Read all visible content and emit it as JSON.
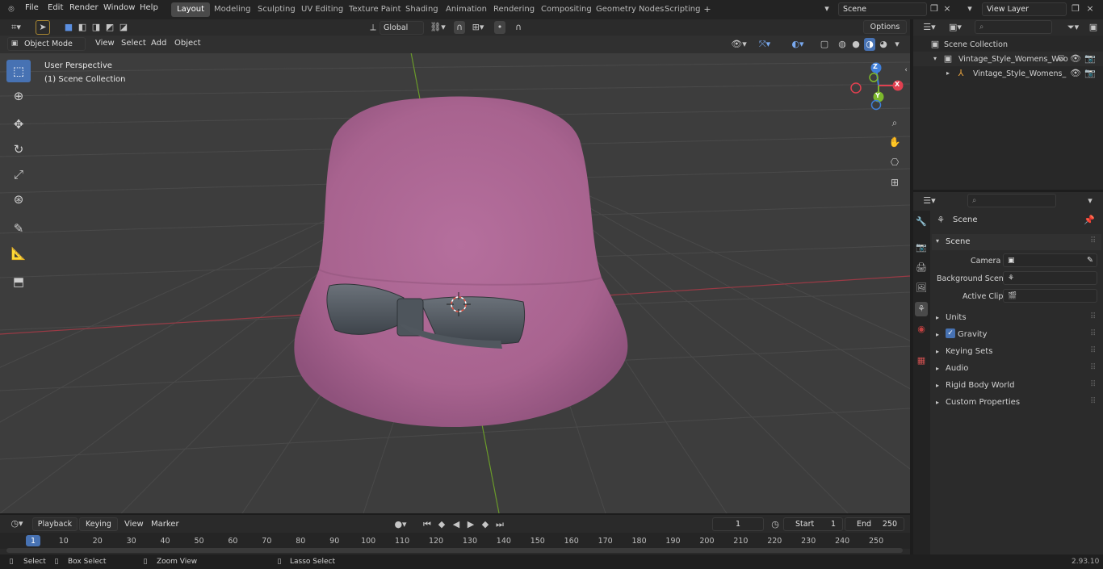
{
  "topbar": {
    "menus": [
      "File",
      "Edit",
      "Render",
      "Window",
      "Help"
    ],
    "tabs": [
      "Layout",
      "Modeling",
      "Sculpting",
      "UV Editing",
      "Texture Paint",
      "Shading",
      "Animation",
      "Rendering",
      "Compositing",
      "Geometry Nodes",
      "Scripting"
    ],
    "scene": "Scene",
    "view_layer": "View Layer"
  },
  "viewport": {
    "mode": "Object Mode",
    "menus": [
      "View",
      "Select",
      "Add",
      "Object"
    ],
    "transform": "Global",
    "options": "Options",
    "perspective": "User Perspective",
    "collection": "(1) Scene Collection",
    "gizmo": {
      "z": "Z",
      "y": "Y",
      "x": "X"
    }
  },
  "outliner": {
    "root": "Scene Collection",
    "items": [
      "Vintage_Style_Womens_Woo",
      "Vintage_Style_Womens_"
    ]
  },
  "properties": {
    "title": "Scene",
    "section": "Scene",
    "camera_label": "Camera",
    "bg_label": "Background Scene",
    "clip_label": "Active Clip",
    "panels": [
      "Units",
      "Gravity",
      "Keying Sets",
      "Audio",
      "Rigid Body World",
      "Custom Properties"
    ]
  },
  "timeline": {
    "menus": [
      "Playback",
      "Keying",
      "View",
      "Marker"
    ],
    "current": "1",
    "start_label": "Start",
    "start": "1",
    "end_label": "End",
    "end": "250",
    "ticks": [
      "1",
      "10",
      "20",
      "30",
      "40",
      "50",
      "60",
      "70",
      "80",
      "90",
      "100",
      "110",
      "120",
      "130",
      "140",
      "150",
      "160",
      "170",
      "180",
      "190",
      "200",
      "210",
      "220",
      "230",
      "240",
      "250"
    ]
  },
  "status": {
    "items": [
      "Select",
      "Box Select",
      "Zoom View",
      "Lasso Select"
    ],
    "version": "2.93.10"
  },
  "colors": {
    "accent": "#4772b3",
    "hat": "#b06a98",
    "ribbon": "#5a6068"
  }
}
